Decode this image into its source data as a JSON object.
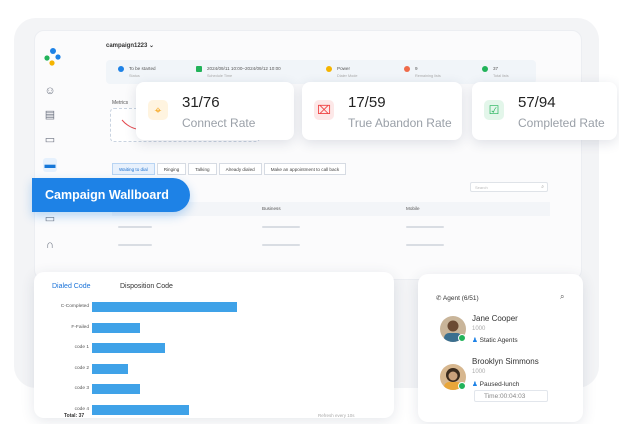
{
  "header": {
    "campaign_select": "campaign1223 ⌄"
  },
  "infobar": {
    "items": [
      {
        "title": "To be started",
        "sub": "Status"
      },
      {
        "title": "2024/09/11 10:00–2024/09/12 10:00",
        "sub": "Schedule Time"
      },
      {
        "title": "Power",
        "sub": "Dialer Mode"
      },
      {
        "title": "9",
        "sub": "Remaining lists"
      },
      {
        "title": "37",
        "sub": "Total lists"
      }
    ]
  },
  "metrics_label": "Metrics",
  "cards": [
    {
      "value": "31/76",
      "label": "Connect Rate",
      "icon": "target-icon",
      "color": "#f59e0b"
    },
    {
      "value": "17/59",
      "label": "True Abandon Rate",
      "icon": "abandon-icon",
      "color": "#ef4444"
    },
    {
      "value": "57/94",
      "label": "Completed Rate",
      "icon": "check-square-icon",
      "color": "#22b35a"
    }
  ],
  "tabs": [
    "Waiting to dial",
    "Ringing",
    "Talking",
    "Already dialed",
    "Make an appointment to call back"
  ],
  "search_placeholder": "Search",
  "table": {
    "headers": [
      "Business",
      "Mobile"
    ]
  },
  "wallboard_label": "Campaign Wallboard",
  "bar_panel": {
    "tabs": [
      "Dialed Code",
      "Disposition Code"
    ],
    "total": "Total: 37",
    "refresh": "Refresh every 10s"
  },
  "chart_data": {
    "type": "bar",
    "orientation": "horizontal",
    "categories": [
      "C-Completed",
      "F-Failed",
      "code 1",
      "code 2",
      "code 3",
      "code 4"
    ],
    "values": [
      12,
      4,
      6,
      3,
      4,
      8
    ],
    "xlim": [
      0,
      24
    ],
    "color": "#3fa2e8"
  },
  "agents": {
    "title": "Agent (6/51)",
    "list": [
      {
        "name": "Jane Cooper",
        "id": "1000",
        "status": "Static Agents"
      },
      {
        "name": "Brooklyn Simmons",
        "id": "1000",
        "status": "Paused-lunch",
        "time": "Time:00:04:03"
      }
    ]
  },
  "colors": {
    "accent": "#1e82e6",
    "bar": "#3fa2e8",
    "online": "#22b35a"
  }
}
